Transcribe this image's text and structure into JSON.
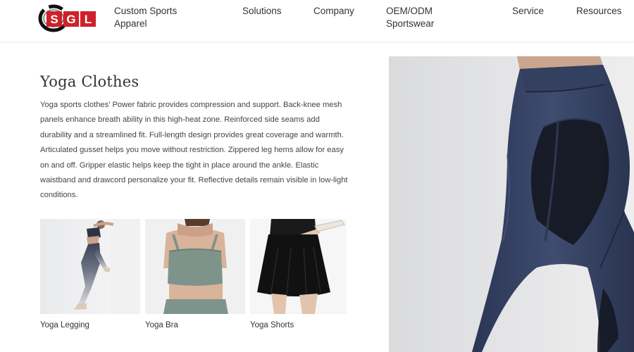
{
  "brand": {
    "logo_text": "SGL"
  },
  "nav": {
    "items": [
      {
        "label": "Custom Sports Apparel"
      },
      {
        "label": "Solutions"
      },
      {
        "label": "Company"
      },
      {
        "label": "OEM/ODM Sportswear"
      },
      {
        "label": "Service"
      },
      {
        "label": "Resources"
      }
    ]
  },
  "main": {
    "title": "Yoga Clothes",
    "description": "Yoga sports clothes' Power fabric provides compression and support. Back-knee mesh panels enhance breath ability in this high-heat zone. Reinforced side seams add durability and a streamlined fit. Full-length design provides great coverage and warmth. Articulated gusset helps you move without restriction. Zippered leg hems allow for easy on and off. Gripper elastic helps keep the tight in place around the ankle. Elastic waistband and drawcord personalize your fit. Reflective details remain visible in low-light conditions.",
    "products": [
      {
        "label": "Yoga Legging"
      },
      {
        "label": "Yoga Bra"
      },
      {
        "label": "Yoga Shorts"
      }
    ]
  },
  "colors": {
    "brand_red": "#d0202a",
    "navy_fabric": "#2f3b5a",
    "sage_green": "#7e948a",
    "black_fabric": "#151515"
  }
}
